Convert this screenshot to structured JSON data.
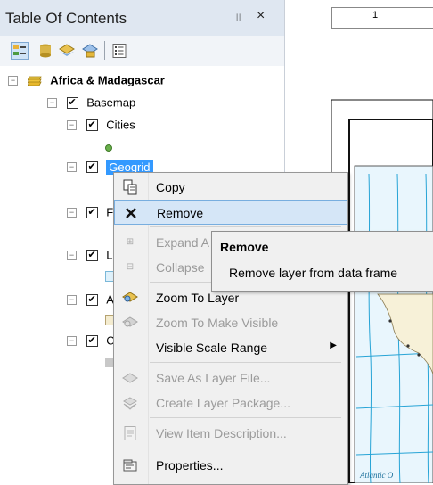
{
  "toc": {
    "title": "Table Of Contents",
    "pin_glyph": "⫫",
    "close_glyph": "×",
    "toolbar": {
      "buttons": [
        "list-by-drawing-order-icon",
        "list-by-source-icon",
        "list-by-visibility-icon",
        "list-by-selection-icon",
        "options-icon"
      ]
    },
    "tree": {
      "dataframe_label": "Africa & Madagascar",
      "basemap_label": "Basemap",
      "cities_label": "Cities",
      "geogrid_label": "Geogrid",
      "partial_f": "F",
      "partial_l": "L",
      "partial_a": "A",
      "partial_c": "C",
      "expand_glyph": "−",
      "check_glyph": "✔"
    }
  },
  "map": {
    "ruler_label": "1",
    "label_bottom": "Atlantic O",
    "accent": "#27a4d6"
  },
  "context_menu": {
    "items": [
      {
        "label": "Copy",
        "icon": "copy-icon",
        "enabled": true
      },
      {
        "label": "Remove",
        "icon": "remove-icon",
        "enabled": true,
        "highlighted": true
      },
      {
        "label": "Expand A",
        "icon": "expand-icon",
        "enabled": false
      },
      {
        "label": "Collapse",
        "icon": "collapse-icon",
        "enabled": false
      },
      {
        "label": "Zoom To Layer",
        "icon": "zoom-to-layer-icon",
        "enabled": true
      },
      {
        "label": "Zoom To Make Visible",
        "icon": "zoom-visible-icon",
        "enabled": false
      },
      {
        "label": "Visible Scale Range",
        "icon": "",
        "enabled": true,
        "submenu": true
      },
      {
        "label": "Save As Layer File...",
        "icon": "save-layer-icon",
        "enabled": false
      },
      {
        "label": "Create Layer Package...",
        "icon": "layer-package-icon",
        "enabled": false
      },
      {
        "label": "View Item Description...",
        "icon": "item-description-icon",
        "enabled": false
      },
      {
        "label": "Properties...",
        "icon": "properties-icon",
        "enabled": true
      }
    ],
    "submenu_glyph": "▶"
  },
  "tooltip": {
    "title": "Remove",
    "body": "Remove layer from data frame"
  }
}
